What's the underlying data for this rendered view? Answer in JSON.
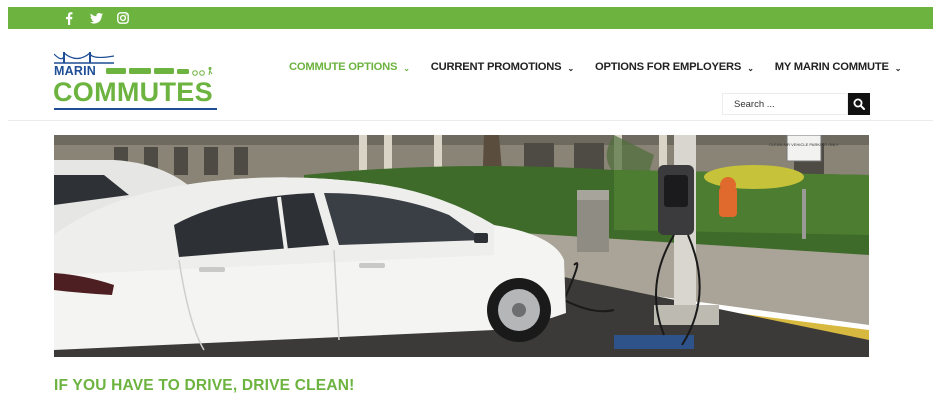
{
  "social": [
    {
      "icon": "facebook-icon"
    },
    {
      "icon": "twitter-icon"
    },
    {
      "icon": "instagram-icon"
    }
  ],
  "logo": {
    "line1": "MARIN",
    "line2": "COMMUTES"
  },
  "nav": {
    "items": [
      {
        "label": "COMMUTE OPTIONS",
        "active": true
      },
      {
        "label": "CURRENT PROMOTIONS",
        "active": false
      },
      {
        "label": "OPTIONS FOR EMPLOYERS",
        "active": false
      },
      {
        "label": "MY MARIN COMMUTE",
        "active": false
      }
    ]
  },
  "search": {
    "placeholder": "Search ..."
  },
  "hero": {
    "sign_text": "CLEAN AIR VEHICLE PARKING ONLY"
  },
  "headline": "IF YOU HAVE TO DRIVE, DRIVE CLEAN!",
  "colors": {
    "brand_green": "#6cb33f",
    "brand_blue": "#1f4e96",
    "text_dark": "#222222"
  }
}
